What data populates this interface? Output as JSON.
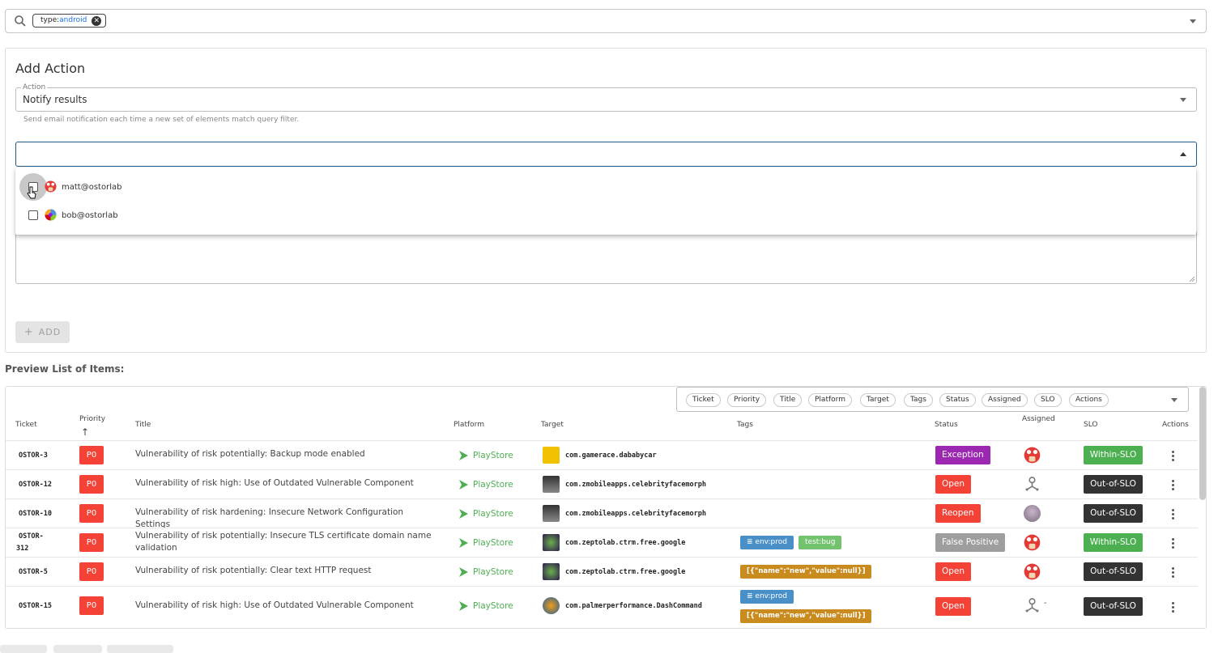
{
  "search": {
    "chip_key": "type:",
    "chip_value": "android"
  },
  "add_action": {
    "title": "Add Action",
    "action_label": "Action",
    "action_value": "Notify results",
    "helper": "Send email notification each time a new set of elements match query filter.",
    "add_button": "ADD",
    "users": [
      {
        "email": "matt@ostorlab",
        "checked": false
      },
      {
        "email": "bob@ostorlab",
        "checked": false
      }
    ]
  },
  "preview": {
    "title": "Preview List of Items:",
    "column_pills": [
      "Ticket",
      "Priority",
      "Title",
      "Platform",
      "Target",
      "Tags",
      "Status",
      "Assigned",
      "SLO",
      "Actions"
    ],
    "headers": {
      "ticket": "Ticket",
      "priority": "Priority",
      "sort_arrow": "↑",
      "title": "Title",
      "platform": "Platform",
      "target": "Target",
      "tags": "Tags",
      "status": "Status",
      "assigned": "Assigned",
      "slo": "SLO",
      "actions": "Actions"
    },
    "rows": [
      {
        "ticket": "OSTOR-3",
        "priority": "P0",
        "title": "Vulnerability of risk potentially: Backup mode enabled",
        "platform": "PlayStore",
        "target": "com.gamerace.dababycar",
        "tags": [],
        "status": "Exception",
        "assigned": "mushroom-avatar",
        "slo": "Within-SLO"
      },
      {
        "ticket": "OSTOR-12",
        "priority": "P0",
        "title": "Vulnerability of risk high: Use of Outdated Vulnerable Component",
        "platform": "PlayStore",
        "target": "com.zmobileapps.celebrityfacemorph",
        "tags": [],
        "status": "Open",
        "assigned": "unassigned-icon",
        "slo": "Out-of-SLO"
      },
      {
        "ticket": "OSTOR-10",
        "priority": "P0",
        "title": "Vulnerability of risk hardening: Insecure Network Configuration Settings",
        "platform": "PlayStore",
        "target": "com.zmobileapps.celebrityfacemorph",
        "tags": [],
        "status": "Reopen",
        "assigned": "photo-avatar",
        "slo": "Out-of-SLO"
      },
      {
        "ticket_line1": "OSTOR-",
        "ticket_line2": "312",
        "priority": "P0",
        "title": "Vulnerability of risk potentially: Insecure TLS certificate domain name validation",
        "platform": "PlayStore",
        "target": "com.zeptolab.ctrm.free.google",
        "tags": [
          "env:prod",
          "test:bug"
        ],
        "status": "False Positive",
        "assigned": "mushroom-avatar",
        "slo": "Within-SLO"
      },
      {
        "ticket": "OSTOR-5",
        "priority": "P0",
        "title": "Vulnerability of risk potentially: Clear text HTTP request",
        "platform": "PlayStore",
        "target": "com.zeptolab.ctrm.free.google",
        "tags": [
          "[{\"name\":\"new\",\"value\":null}]"
        ],
        "status": "Open",
        "assigned": "mushroom-avatar",
        "slo": "Out-of-SLO"
      },
      {
        "ticket": "OSTOR-15",
        "priority": "P0",
        "title": "Vulnerability of risk high: Use of Outdated Vulnerable Component",
        "platform": "PlayStore",
        "target": "com.palmerperformance.DashCommand",
        "tags": [
          "env:prod",
          "[{\"name\":\"new\",\"value\":null}]"
        ],
        "status": "Open",
        "assigned": "unassigned-icon",
        "assigned_extra": "-",
        "slo": "Out-of-SLO"
      }
    ]
  },
  "colors": {
    "priority_p0": "#f44336",
    "status_exception": "#9c27b0",
    "status_open": "#f44336",
    "status_false_positive": "#9e9e9e",
    "slo_within": "#4caf50",
    "slo_out": "#333333",
    "platform": "#4caf50",
    "tag_env": "#4a90c8",
    "tag_test": "#72c26e",
    "tag_json": "#c98a1e"
  }
}
